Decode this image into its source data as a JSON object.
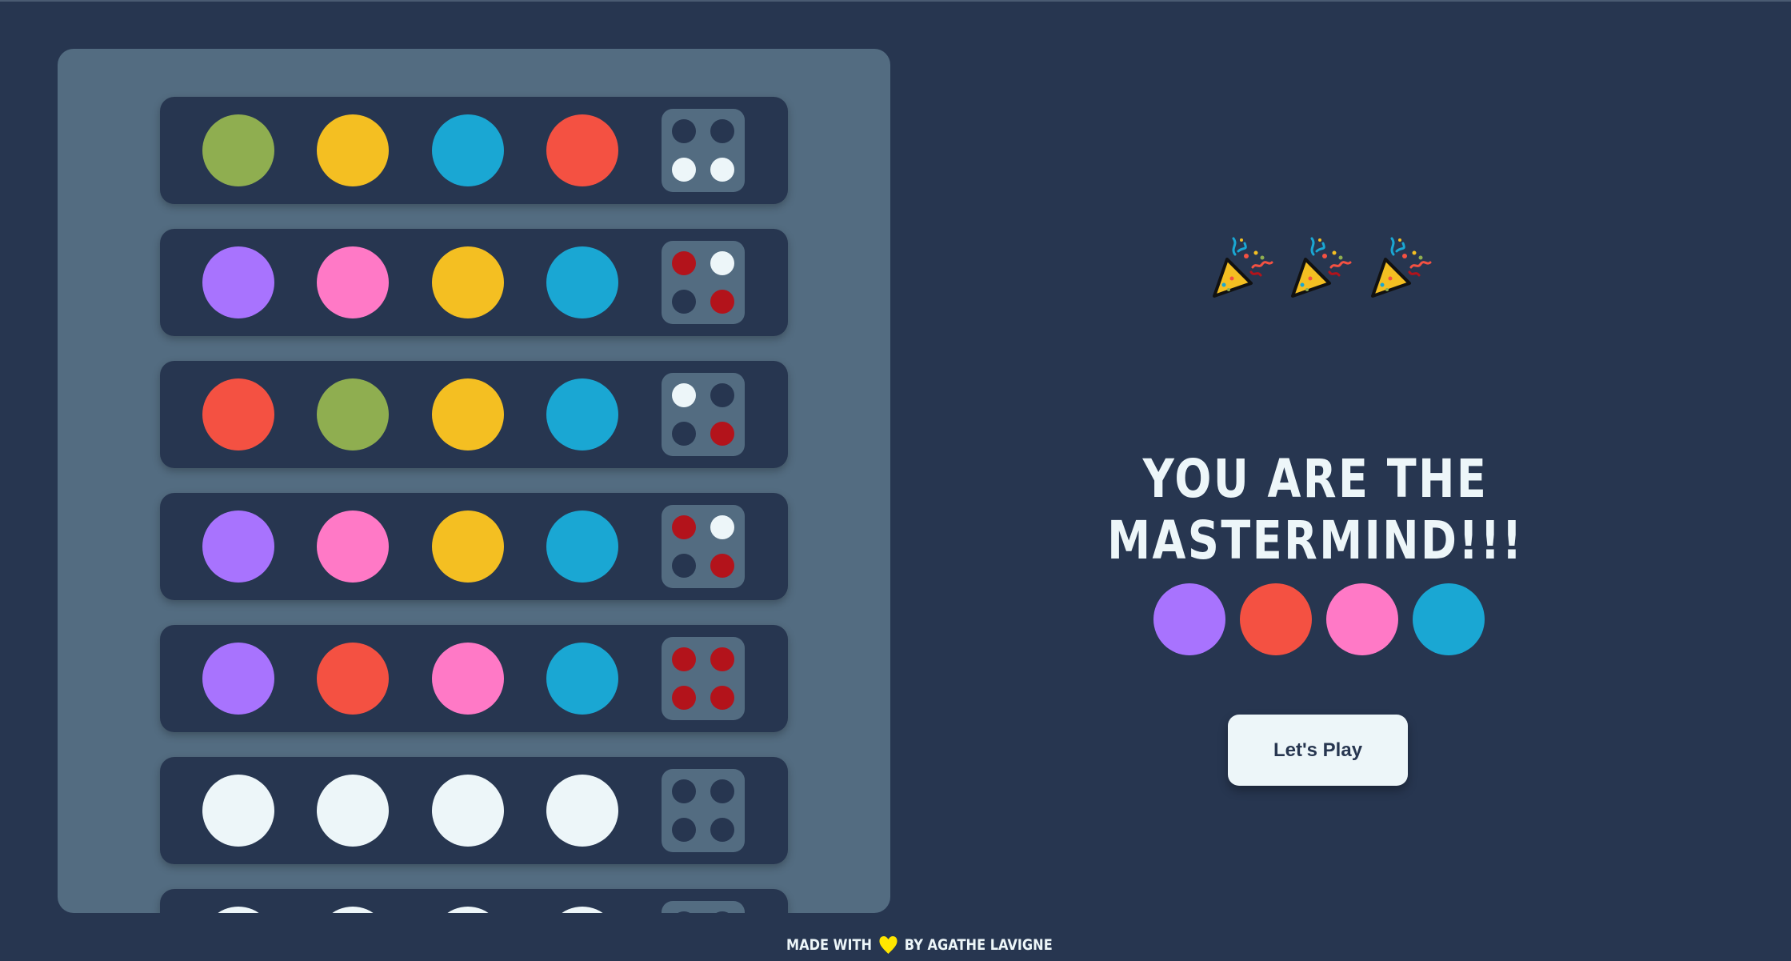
{
  "colors": {
    "background": "#273650",
    "board": "#536c81",
    "row": "#273650",
    "feedback_empty": "#273650",
    "feedback_white": "#edf6f9",
    "feedback_red": "#b3131b",
    "heart": "#ffe600"
  },
  "board": {
    "rows": [
      {
        "pegs": [
          "#8fae50",
          "#f4bf22",
          "#1aa7d3",
          "#f45142"
        ],
        "feedback": [
          "empty",
          "empty",
          "white",
          "white"
        ]
      },
      {
        "pegs": [
          "#a873fe",
          "#ff79c6",
          "#f4bf22",
          "#1aa7d3"
        ],
        "feedback": [
          "red",
          "white",
          "empty",
          "red"
        ]
      },
      {
        "pegs": [
          "#f45142",
          "#8fae50",
          "#f4bf22",
          "#1aa7d3"
        ],
        "feedback": [
          "white",
          "empty",
          "empty",
          "red"
        ]
      },
      {
        "pegs": [
          "#a873fe",
          "#ff79c6",
          "#f4bf22",
          "#1aa7d3"
        ],
        "feedback": [
          "red",
          "white",
          "empty",
          "red"
        ]
      },
      {
        "pegs": [
          "#a873fe",
          "#f45142",
          "#ff79c6",
          "#1aa7d3"
        ],
        "feedback": [
          "red",
          "red",
          "red",
          "red"
        ]
      },
      {
        "pegs": [
          "#edf6f9",
          "#edf6f9",
          "#edf6f9",
          "#edf6f9"
        ],
        "feedback": [
          "empty",
          "empty",
          "empty",
          "empty"
        ]
      },
      {
        "pegs": [
          "#edf6f9",
          "#edf6f9",
          "#edf6f9",
          "#edf6f9"
        ],
        "feedback": [
          "empty",
          "empty",
          "empty",
          "empty"
        ]
      }
    ]
  },
  "win": {
    "icons": [
      "party-popper-icon",
      "party-popper-icon",
      "party-popper-icon"
    ],
    "title": "YOU ARE THE MASTERMIND!!!",
    "solution": [
      "#a873fe",
      "#f45142",
      "#ff79c6",
      "#1aa7d3"
    ],
    "button_label": "Let's Play"
  },
  "footer": {
    "prefix": "MADE WITH",
    "icon": "heart-icon",
    "suffix": "BY AGATHE LAVIGNE"
  }
}
